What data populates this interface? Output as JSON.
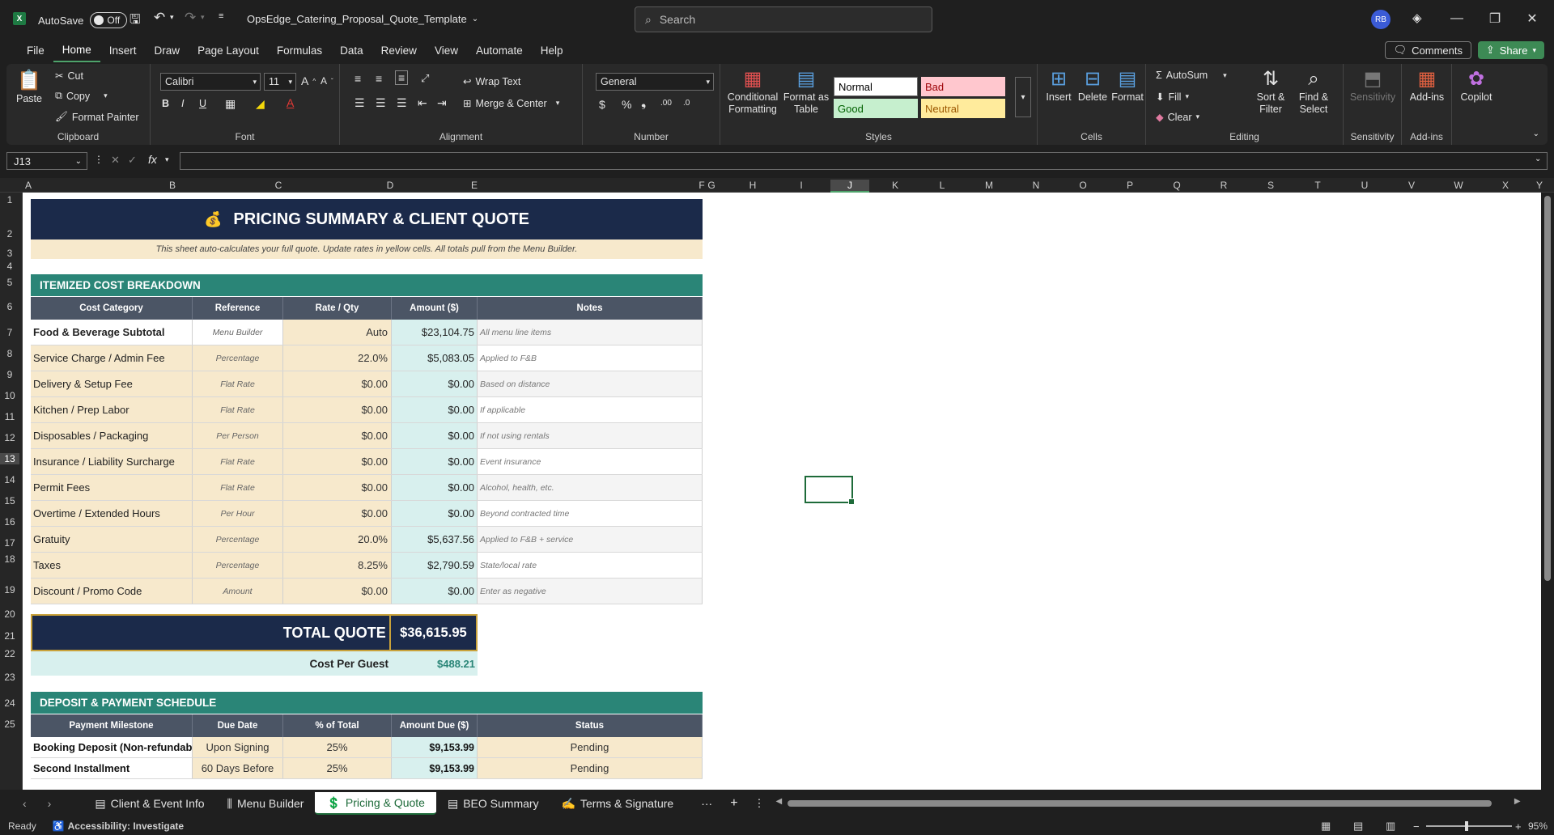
{
  "title_bar": {
    "autosave_label": "AutoSave",
    "autosave_state": "Off",
    "filename": "OpsEdge_Catering_Proposal_Quote_Template",
    "search_placeholder": "Search",
    "avatar_initials": "RB"
  },
  "menu": [
    "File",
    "Home",
    "Insert",
    "Draw",
    "Page Layout",
    "Formulas",
    "Data",
    "Review",
    "View",
    "Automate",
    "Help"
  ],
  "menu_active": "Home",
  "comments_label": "Comments",
  "share_label": "Share",
  "ribbon": {
    "clipboard": {
      "paste": "Paste",
      "cut": "Cut",
      "copy": "Copy",
      "format_painter": "Format Painter",
      "label": "Clipboard"
    },
    "font": {
      "name": "Calibri",
      "size": "11",
      "label": "Font"
    },
    "alignment": {
      "wrap": "Wrap Text",
      "merge": "Merge & Center",
      "label": "Alignment"
    },
    "number": {
      "format": "General",
      "label": "Number"
    },
    "styles": {
      "conditional": "Conditional Formatting",
      "format_table": "Format as Table",
      "normal": "Normal",
      "bad": "Bad",
      "good": "Good",
      "neutral": "Neutral",
      "label": "Styles"
    },
    "cells": {
      "insert": "Insert",
      "delete": "Delete",
      "format": "Format",
      "label": "Cells"
    },
    "editing": {
      "autosum": "AutoSum",
      "fill": "Fill",
      "clear": "Clear",
      "sort": "Sort & Filter",
      "find": "Find & Select",
      "label": "Editing"
    },
    "sensitivity": {
      "btn": "Sensitivity",
      "label": "Sensitivity"
    },
    "addins": {
      "btn": "Add-ins",
      "label": "Add-ins"
    },
    "copilot": "Copilot"
  },
  "name_box": "J13",
  "columns": [
    "A",
    "B",
    "C",
    "D",
    "E",
    "F",
    "G",
    "H",
    "I",
    "J",
    "K",
    "L",
    "M",
    "N",
    "O",
    "P",
    "Q",
    "R",
    "S",
    "T",
    "U",
    "V",
    "W",
    "X",
    "Y"
  ],
  "rows": [
    "1",
    "2",
    "3",
    "4",
    "5",
    "6",
    "7",
    "8",
    "9",
    "10",
    "11",
    "12",
    "13",
    "14",
    "15",
    "16",
    "17",
    "18",
    "19",
    "20",
    "21",
    "22",
    "23",
    "24",
    "25"
  ],
  "sheet": {
    "title": "PRICING SUMMARY & CLIENT QUOTE",
    "subtitle": "This sheet auto-calculates your full quote. Update rates in yellow cells. All totals pull from the Menu Builder.",
    "itemized_header": "ITEMIZED COST BREAKDOWN",
    "cost_columns": [
      "Cost Category",
      "Reference",
      "Rate / Qty",
      "Amount ($)",
      "Notes"
    ],
    "cost_rows": [
      {
        "category": "Food & Beverage Subtotal",
        "reference": "Menu Builder",
        "rate": "Auto",
        "amount": "$23,104.75",
        "notes": "All menu line items"
      },
      {
        "category": "Service Charge / Admin Fee",
        "reference": "Percentage",
        "rate": "22.0%",
        "amount": "$5,083.05",
        "notes": "Applied to F&B"
      },
      {
        "category": "Delivery & Setup Fee",
        "reference": "Flat Rate",
        "rate": "$0.00",
        "amount": "$0.00",
        "notes": "Based on distance"
      },
      {
        "category": "Kitchen / Prep Labor",
        "reference": "Flat Rate",
        "rate": "$0.00",
        "amount": "$0.00",
        "notes": "If applicable"
      },
      {
        "category": "Disposables / Packaging",
        "reference": "Per Person",
        "rate": "$0.00",
        "amount": "$0.00",
        "notes": "If not using rentals"
      },
      {
        "category": "Insurance / Liability Surcharge",
        "reference": "Flat Rate",
        "rate": "$0.00",
        "amount": "$0.00",
        "notes": "Event insurance"
      },
      {
        "category": "Permit Fees",
        "reference": "Flat Rate",
        "rate": "$0.00",
        "amount": "$0.00",
        "notes": "Alcohol, health, etc."
      },
      {
        "category": "Overtime / Extended Hours",
        "reference": "Per Hour",
        "rate": "$0.00",
        "amount": "$0.00",
        "notes": "Beyond contracted time"
      },
      {
        "category": "Gratuity",
        "reference": "Percentage",
        "rate": "20.0%",
        "amount": "$5,637.56",
        "notes": "Applied to F&B + service"
      },
      {
        "category": "Taxes",
        "reference": "Percentage",
        "rate": "8.25%",
        "amount": "$2,790.59",
        "notes": "State/local rate"
      },
      {
        "category": "Discount / Promo Code",
        "reference": "Amount",
        "rate": "$0.00",
        "amount": "$0.00",
        "notes": "Enter as negative"
      }
    ],
    "total_label": "TOTAL QUOTE",
    "total_value": "$36,615.95",
    "cpg_label": "Cost Per Guest",
    "cpg_value": "$488.21",
    "deposit_header": "DEPOSIT & PAYMENT SCHEDULE",
    "pay_columns": [
      "Payment Milestone",
      "Due Date",
      "% of Total",
      "Amount Due ($)",
      "Status"
    ],
    "pay_rows": [
      {
        "milestone": "Booking Deposit (Non-refundab",
        "due": "Upon Signing",
        "pct": "25%",
        "amount": "$9,153.99",
        "status": "Pending"
      },
      {
        "milestone": "Second Installment",
        "due": "60 Days Before",
        "pct": "25%",
        "amount": "$9,153.99",
        "status": "Pending"
      }
    ]
  },
  "tabs": [
    "Client & Event Info",
    "Menu Builder",
    "Pricing & Quote",
    "BEO Summary",
    "Terms & Signature"
  ],
  "active_tab": "Pricing & Quote",
  "status": {
    "ready": "Ready",
    "accessibility": "Accessibility: Investigate",
    "zoom": "95%"
  }
}
